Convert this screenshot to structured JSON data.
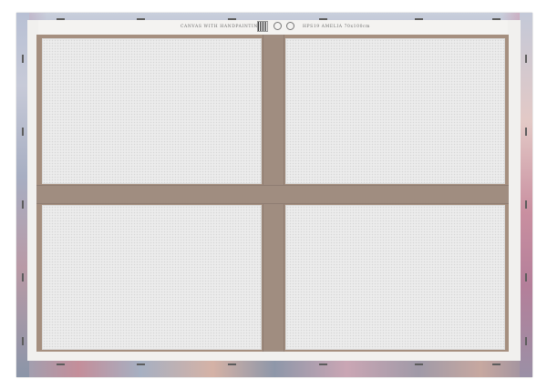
{
  "label": {
    "left_text": "CANVAS WITH HANDPAINTING",
    "right_text": "HPS19 AMELIA 70x100cm"
  },
  "icons": [
    "barcode-icon",
    "recycle-icon",
    "eco-icon"
  ],
  "colors": {
    "stretcher_wood": "#a08d80",
    "canvas_back": "#ececec",
    "frame_white": "#f1f0ee"
  }
}
